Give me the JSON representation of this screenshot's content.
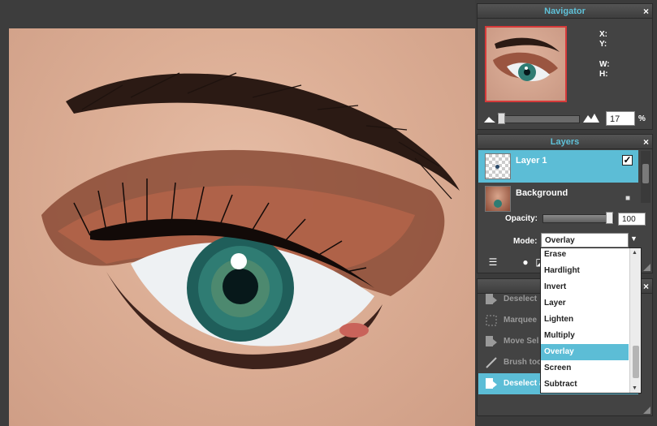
{
  "navigator": {
    "title": "Navigator",
    "close": "×",
    "x_label": "X:",
    "y_label": "Y:",
    "w_label": "W:",
    "h_label": "H:",
    "zoom_value": "17",
    "zoom_unit": "%",
    "zoom_slider_fraction": 0.03
  },
  "layers": {
    "title": "Layers",
    "close": "×",
    "items": [
      {
        "name": "Layer 1",
        "visible_check": "✓",
        "active": true
      },
      {
        "name": "Background",
        "lock": "🔒",
        "active": false
      }
    ],
    "opacity_label": "Opacity:",
    "opacity_value": "100",
    "mode_label": "Mode:",
    "mode_value": "Overlay"
  },
  "history": {
    "close": "×",
    "items": [
      {
        "label": "Deselect",
        "icon": "document-arrow-icon",
        "active": false
      },
      {
        "label": "Marquee",
        "icon": "marquee-icon",
        "active": false
      },
      {
        "label": "Move Sel",
        "icon": "document-arrow-icon",
        "active": false
      },
      {
        "label": "Brush too",
        "icon": "brush-icon",
        "active": false
      },
      {
        "label": "Deselect a",
        "icon": "document-arrow-icon",
        "active": true
      }
    ]
  },
  "mode_dropdown": {
    "options": [
      "Erase",
      "Hardlight",
      "Invert",
      "Layer",
      "Lighten",
      "Multiply",
      "Overlay",
      "Screen",
      "Subtract"
    ],
    "selected": "Overlay"
  },
  "colors": {
    "accent": "#5cbdd6",
    "panel_bg": "#434343",
    "title_text": "#5fc1d8"
  }
}
